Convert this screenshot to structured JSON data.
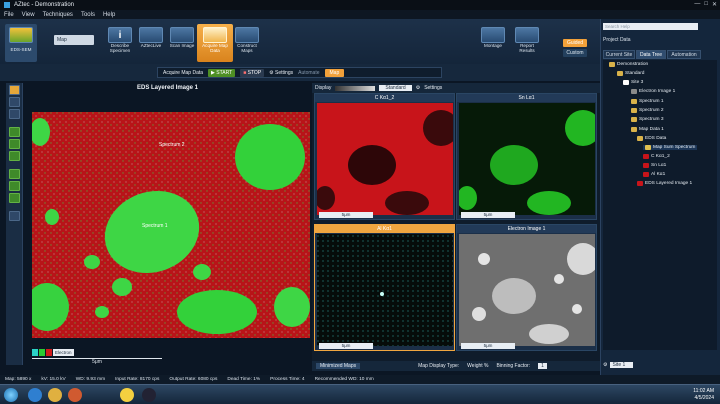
{
  "app": {
    "title": "AZtec - Demonstration",
    "window_controls": [
      "—",
      "□",
      "✕"
    ]
  },
  "menu": [
    "File",
    "View",
    "Techniques",
    "Tools",
    "Help"
  ],
  "ribbon": {
    "mode": "EDS-SEM",
    "crumb": "Map",
    "steps": [
      {
        "label": "Describe\nSpecimen",
        "icon": "info-icon"
      },
      {
        "label": "AZtecLive",
        "icon": "live-icon"
      },
      {
        "label": "Scan Image",
        "icon": "scan-icon"
      },
      {
        "label": "Acquire Map\nData",
        "icon": "map-icon",
        "active": true
      },
      {
        "label": "Construct\nMaps",
        "icon": "construct-icon"
      }
    ],
    "right": [
      {
        "label": "Montage"
      },
      {
        "label": "Report\nResults"
      }
    ],
    "guided": "Guided",
    "custom": "Custom"
  },
  "acquire": {
    "label": "Acquire Map Data",
    "start": "START",
    "stop": "STOP",
    "settings": "Settings",
    "automate": "Automate",
    "map": "Map"
  },
  "image_panel": {
    "title": "EDS Layered Image 1",
    "spectrum1": "Spectrum 1",
    "spectrum2": "Spectrum 2",
    "legend_label": "Electron",
    "scale": "5μm"
  },
  "maps": {
    "display": "Display",
    "standard": "Standard",
    "settings": "Settings",
    "cells": [
      {
        "name": "C Kα1_2",
        "scale": "5μm",
        "color": "#c8141a"
      },
      {
        "name": "Sn Lα1",
        "scale": "5μm",
        "color": "#12c012"
      },
      {
        "name": "Al Kα1",
        "scale": "5μm",
        "color": "#40d8d0",
        "selected": true
      },
      {
        "name": "Electron Image 1",
        "scale": "5μm",
        "color": "#b8b8b8"
      }
    ],
    "tab": "Minimized Maps",
    "display_type_label": "Map Display Type:",
    "display_type": "Weight %",
    "binning_label": "Binning Factor:",
    "binning": "1"
  },
  "right_panel": {
    "search": "Search Help",
    "project_label": "Project Data",
    "tabs": [
      "Current Site",
      "Data Tree",
      "Automation"
    ],
    "tree": [
      "Demonstration",
      "Standard",
      "Site 3",
      "Electron Image 1",
      "Spectrum 1",
      "Spectrum 2",
      "Spectrum 3",
      "Map Data 1",
      "EDS Data",
      "Map Sum Spectrum",
      "C Kα1_2",
      "Sn Lα1",
      "Al Kα1",
      "EDS Layered Image 1"
    ],
    "site_select": "Site 1"
  },
  "status": {
    "mag": "Map: 5890 x",
    "kv": "kV: 15.0 kV",
    "wd": "WD: 9.93 mm",
    "input": "Input Rate: 8170 cps",
    "output": "Output Rate: 6080 cps",
    "dead": "Dead Time: 1%",
    "process": "Process Time: 4",
    "recommended": "Recommended WD: 10 mm"
  },
  "taskbar": {
    "time": "11:02 AM",
    "date": "4/5/2024"
  }
}
